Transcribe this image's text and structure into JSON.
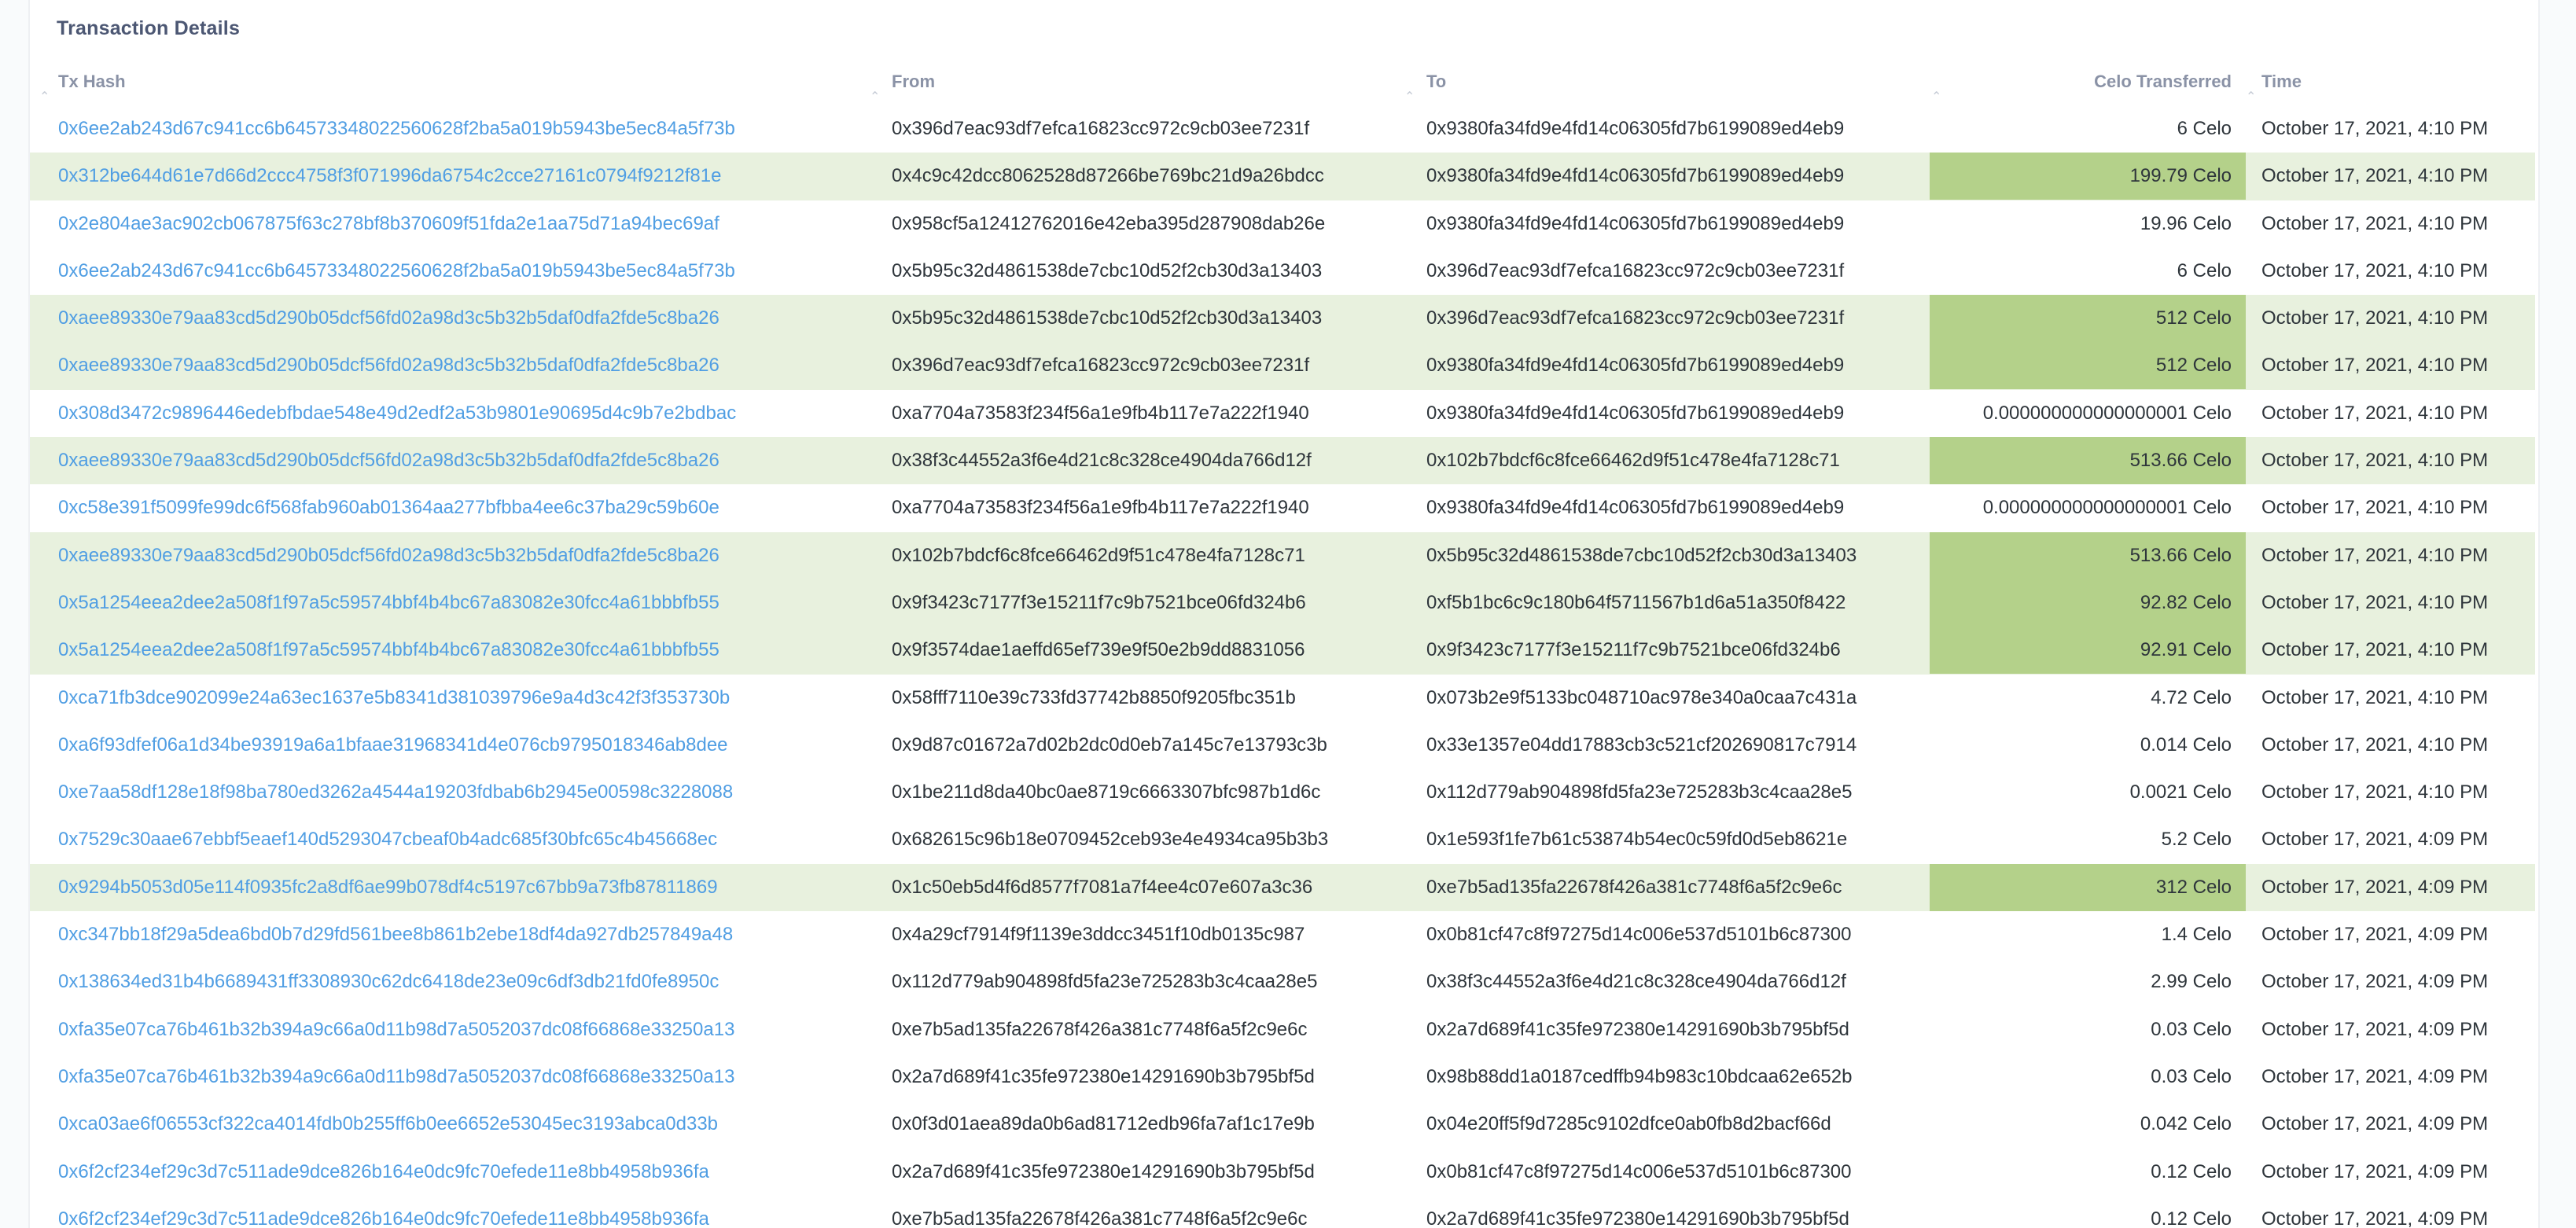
{
  "card": {
    "title": "Transaction Details"
  },
  "columns": [
    "Tx Hash",
    "From",
    "To",
    "Celo Transferred",
    "Time"
  ],
  "colors": {
    "link": "#509ee3",
    "row_highlight": "#e8f1de",
    "value_highlight": "#b4d18a"
  },
  "rows": [
    {
      "hash": "0x6ee2ab243d67c941cc6b64573348022560628f2ba5a019b5943be5ec84a5f73b",
      "from": "0x396d7eac93df7efca16823cc972c9cb03ee7231f",
      "to": "0x9380fa34fd9e4fd14c06305fd7b6199089ed4eb9",
      "celo": "6 Celo",
      "time": "October 17, 2021, 4:10 PM",
      "highlight": false
    },
    {
      "hash": "0x312be644d61e7d66d2ccc4758f3f071996da6754c2cce27161c0794f9212f81e",
      "from": "0x4c9c42dcc8062528d87266be769bc21d9a26bdcc",
      "to": "0x9380fa34fd9e4fd14c06305fd7b6199089ed4eb9",
      "celo": "199.79 Celo",
      "time": "October 17, 2021, 4:10 PM",
      "highlight": true
    },
    {
      "hash": "0x2e804ae3ac902cb067875f63c278bf8b370609f51fda2e1aa75d71a94bec69af",
      "from": "0x958cf5a12412762016e42eba395d287908dab26e",
      "to": "0x9380fa34fd9e4fd14c06305fd7b6199089ed4eb9",
      "celo": "19.96 Celo",
      "time": "October 17, 2021, 4:10 PM",
      "highlight": false
    },
    {
      "hash": "0x6ee2ab243d67c941cc6b64573348022560628f2ba5a019b5943be5ec84a5f73b",
      "from": "0x5b95c32d4861538de7cbc10d52f2cb30d3a13403",
      "to": "0x396d7eac93df7efca16823cc972c9cb03ee7231f",
      "celo": "6 Celo",
      "time": "October 17, 2021, 4:10 PM",
      "highlight": false
    },
    {
      "hash": "0xaee89330e79aa83cd5d290b05dcf56fd02a98d3c5b32b5daf0dfa2fde5c8ba26",
      "from": "0x5b95c32d4861538de7cbc10d52f2cb30d3a13403",
      "to": "0x396d7eac93df7efca16823cc972c9cb03ee7231f",
      "celo": "512 Celo",
      "time": "October 17, 2021, 4:10 PM",
      "highlight": true
    },
    {
      "hash": "0xaee89330e79aa83cd5d290b05dcf56fd02a98d3c5b32b5daf0dfa2fde5c8ba26",
      "from": "0x396d7eac93df7efca16823cc972c9cb03ee7231f",
      "to": "0x9380fa34fd9e4fd14c06305fd7b6199089ed4eb9",
      "celo": "512 Celo",
      "time": "October 17, 2021, 4:10 PM",
      "highlight": true
    },
    {
      "hash": "0x308d3472c9896446edebfbdae548e49d2edf2a53b9801e90695d4c9b7e2bdbac",
      "from": "0xa7704a73583f234f56a1e9fb4b117e7a222f1940",
      "to": "0x9380fa34fd9e4fd14c06305fd7b6199089ed4eb9",
      "celo": "0.000000000000000001 Celo",
      "time": "October 17, 2021, 4:10 PM",
      "highlight": false
    },
    {
      "hash": "0xaee89330e79aa83cd5d290b05dcf56fd02a98d3c5b32b5daf0dfa2fde5c8ba26",
      "from": "0x38f3c44552a3f6e4d21c8c328ce4904da766d12f",
      "to": "0x102b7bdcf6c8fce66462d9f51c478e4fa7128c71",
      "celo": "513.66 Celo",
      "time": "October 17, 2021, 4:10 PM",
      "highlight": true
    },
    {
      "hash": "0xc58e391f5099fe99dc6f568fab960ab01364aa277bfbba4ee6c37ba29c59b60e",
      "from": "0xa7704a73583f234f56a1e9fb4b117e7a222f1940",
      "to": "0x9380fa34fd9e4fd14c06305fd7b6199089ed4eb9",
      "celo": "0.000000000000000001 Celo",
      "time": "October 17, 2021, 4:10 PM",
      "highlight": false
    },
    {
      "hash": "0xaee89330e79aa83cd5d290b05dcf56fd02a98d3c5b32b5daf0dfa2fde5c8ba26",
      "from": "0x102b7bdcf6c8fce66462d9f51c478e4fa7128c71",
      "to": "0x5b95c32d4861538de7cbc10d52f2cb30d3a13403",
      "celo": "513.66 Celo",
      "time": "October 17, 2021, 4:10 PM",
      "highlight": true
    },
    {
      "hash": "0x5a1254eea2dee2a508f1f97a5c59574bbf4b4bc67a83082e30fcc4a61bbbfb55",
      "from": "0x9f3423c7177f3e15211f7c9b7521bce06fd324b6",
      "to": "0xf5b1bc6c9c180b64f5711567b1d6a51a350f8422",
      "celo": "92.82 Celo",
      "time": "October 17, 2021, 4:10 PM",
      "highlight": true
    },
    {
      "hash": "0x5a1254eea2dee2a508f1f97a5c59574bbf4b4bc67a83082e30fcc4a61bbbfb55",
      "from": "0x9f3574dae1aeffd65ef739e9f50e2b9dd8831056",
      "to": "0x9f3423c7177f3e15211f7c9b7521bce06fd324b6",
      "celo": "92.91 Celo",
      "time": "October 17, 2021, 4:10 PM",
      "highlight": true
    },
    {
      "hash": "0xca71fb3dce902099e24a63ec1637e5b8341d381039796e9a4d3c42f3f353730b",
      "from": "0x58fff7110e39c733fd37742b8850f9205fbc351b",
      "to": "0x073b2e9f5133bc048710ac978e340a0caa7c431a",
      "celo": "4.72 Celo",
      "time": "October 17, 2021, 4:10 PM",
      "highlight": false
    },
    {
      "hash": "0xa6f93dfef06a1d34be93919a6a1bfaae31968341d4e076cb9795018346ab8dee",
      "from": "0x9d87c01672a7d02b2dc0d0eb7a145c7e13793c3b",
      "to": "0x33e1357e04dd17883cb3c521cf202690817c7914",
      "celo": "0.014 Celo",
      "time": "October 17, 2021, 4:10 PM",
      "highlight": false
    },
    {
      "hash": "0xe7aa58df128e18f98ba780ed3262a4544a19203fdbab6b2945e00598c3228088",
      "from": "0x1be211d8da40bc0ae8719c6663307bfc987b1d6c",
      "to": "0x112d779ab904898fd5fa23e725283b3c4caa28e5",
      "celo": "0.0021 Celo",
      "time": "October 17, 2021, 4:10 PM",
      "highlight": false
    },
    {
      "hash": "0x7529c30aae67ebbf5eaef140d5293047cbeaf0b4adc685f30bfc65c4b45668ec",
      "from": "0x682615c96b18e0709452ceb93e4e4934ca95b3b3",
      "to": "0x1e593f1fe7b61c53874b54ec0c59fd0d5eb8621e",
      "celo": "5.2 Celo",
      "time": "October 17, 2021, 4:09 PM",
      "highlight": false
    },
    {
      "hash": "0x9294b5053d05e114f0935fc2a8df6ae99b078df4c5197c67bb9a73fb87811869",
      "from": "0x1c50eb5d4f6d8577f7081a7f4ee4c07e607a3c36",
      "to": "0xe7b5ad135fa22678f426a381c7748f6a5f2c9e6c",
      "celo": "312 Celo",
      "time": "October 17, 2021, 4:09 PM",
      "highlight": true
    },
    {
      "hash": "0xc347bb18f29a5dea6bd0b7d29fd561bee8b861b2ebe18df4da927db257849a48",
      "from": "0x4a29cf7914f9f1139e3ddcc3451f10db0135c987",
      "to": "0x0b81cf47c8f97275d14c006e537d5101b6c87300",
      "celo": "1.4 Celo",
      "time": "October 17, 2021, 4:09 PM",
      "highlight": false
    },
    {
      "hash": "0x138634ed31b4b6689431ff3308930c62dc6418de23e09c6df3db21fd0fe8950c",
      "from": "0x112d779ab904898fd5fa23e725283b3c4caa28e5",
      "to": "0x38f3c44552a3f6e4d21c8c328ce4904da766d12f",
      "celo": "2.99 Celo",
      "time": "October 17, 2021, 4:09 PM",
      "highlight": false
    },
    {
      "hash": "0xfa35e07ca76b461b32b394a9c66a0d11b98d7a5052037dc08f66868e33250a13",
      "from": "0xe7b5ad135fa22678f426a381c7748f6a5f2c9e6c",
      "to": "0x2a7d689f41c35fe972380e14291690b3b795bf5d",
      "celo": "0.03 Celo",
      "time": "October 17, 2021, 4:09 PM",
      "highlight": false
    },
    {
      "hash": "0xfa35e07ca76b461b32b394a9c66a0d11b98d7a5052037dc08f66868e33250a13",
      "from": "0x2a7d689f41c35fe972380e14291690b3b795bf5d",
      "to": "0x98b88dd1a0187cedffb94b983c10bdcaa62e652b",
      "celo": "0.03 Celo",
      "time": "October 17, 2021, 4:09 PM",
      "highlight": false
    },
    {
      "hash": "0xca03ae6f06553cf322ca4014fdb0b255ff6b0ee6652e53045ec3193abca0d33b",
      "from": "0x0f3d01aea89da0b6ad81712edb96fa7af1c17e9b",
      "to": "0x04e20ff5f9d7285c9102dfce0ab0fb8d2bacf66d",
      "celo": "0.042 Celo",
      "time": "October 17, 2021, 4:09 PM",
      "highlight": false
    },
    {
      "hash": "0x6f2cf234ef29c3d7c511ade9dce826b164e0dc9fc70efede11e8bb4958b936fa",
      "from": "0x2a7d689f41c35fe972380e14291690b3b795bf5d",
      "to": "0x0b81cf47c8f97275d14c006e537d5101b6c87300",
      "celo": "0.12 Celo",
      "time": "October 17, 2021, 4:09 PM",
      "highlight": false
    },
    {
      "hash": "0x6f2cf234ef29c3d7c511ade9dce826b164e0dc9fc70efede11e8bb4958b936fa",
      "from": "0xe7b5ad135fa22678f426a381c7748f6a5f2c9e6c",
      "to": "0x2a7d689f41c35fe972380e14291690b3b795bf5d",
      "celo": "0.12 Celo",
      "time": "October 17, 2021, 4:09 PM",
      "highlight": false
    }
  ]
}
